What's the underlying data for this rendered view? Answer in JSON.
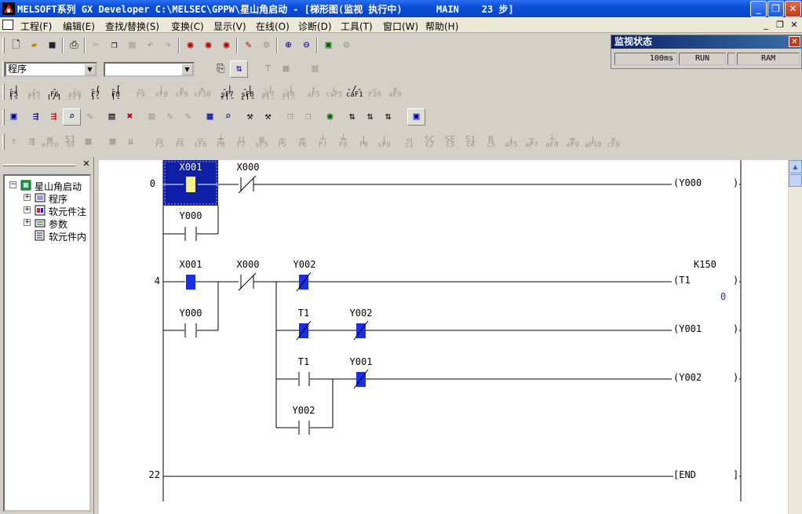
{
  "window": {
    "title": "MELSOFT系列 GX Developer C:\\MELSEC\\GPPW\\星山角启动 - [梯形图(监视 执行中)      MAIN    23 步]"
  },
  "menu": [
    "工程(F)",
    "编辑(E)",
    "查找/替换(S)",
    "变换(C)",
    "显示(V)",
    "在线(O)",
    "诊断(D)",
    "工具(T)",
    "窗口(W)",
    "帮助(H)"
  ],
  "toolbar": {
    "mode_combo": "程序",
    "second_combo": "",
    "row3": [
      "F5",
      "sF5",
      "F6",
      "sF6",
      "F7",
      "F8",
      "F9",
      "sF9",
      "cF9",
      "cF10",
      "sF7",
      "sF8",
      "aF7",
      "aF8",
      "aF5",
      "caF5",
      "caF10",
      "F10",
      "aF9"
    ],
    "row5": [
      "F5",
      "F6",
      "sF6",
      "F8",
      "F7",
      "sF5",
      "F5",
      "F6",
      "F7",
      "F8",
      "F9",
      "sF9",
      "c1",
      "c2",
      "c3",
      "c4",
      "c5",
      "aF5",
      "aF7",
      "aF8",
      "aF9",
      "aF10",
      "cF9"
    ]
  },
  "monitor_status": {
    "title": "监视状态",
    "scan_time": "100ms",
    "state": "RUN",
    "memory": "RAM"
  },
  "tree": {
    "root": "星山角启动",
    "items": [
      "程序",
      "软元件注",
      "参数",
      "软元件内"
    ]
  },
  "ladder": {
    "step0": "0",
    "step1": "4",
    "step2": "22",
    "c_x001_a": "X001",
    "c_x000_a": "X000",
    "c_y000_a": "Y000",
    "coil_y000": "(Y000",
    "c_x001_b": "X001",
    "c_x000_b": "X000",
    "c_y002_a": "Y002",
    "timer_const": "K150",
    "coil_t1": "(T1",
    "timer_value": "0",
    "c_y000_b": "Y000",
    "c_t1_a": "T1",
    "c_y002_b": "Y002",
    "coil_y001": "(Y001",
    "c_t1_b": "T1",
    "c_y001": "Y001",
    "coil_y002": "(Y002",
    "c_y002_c": "Y002",
    "end": "[END"
  }
}
